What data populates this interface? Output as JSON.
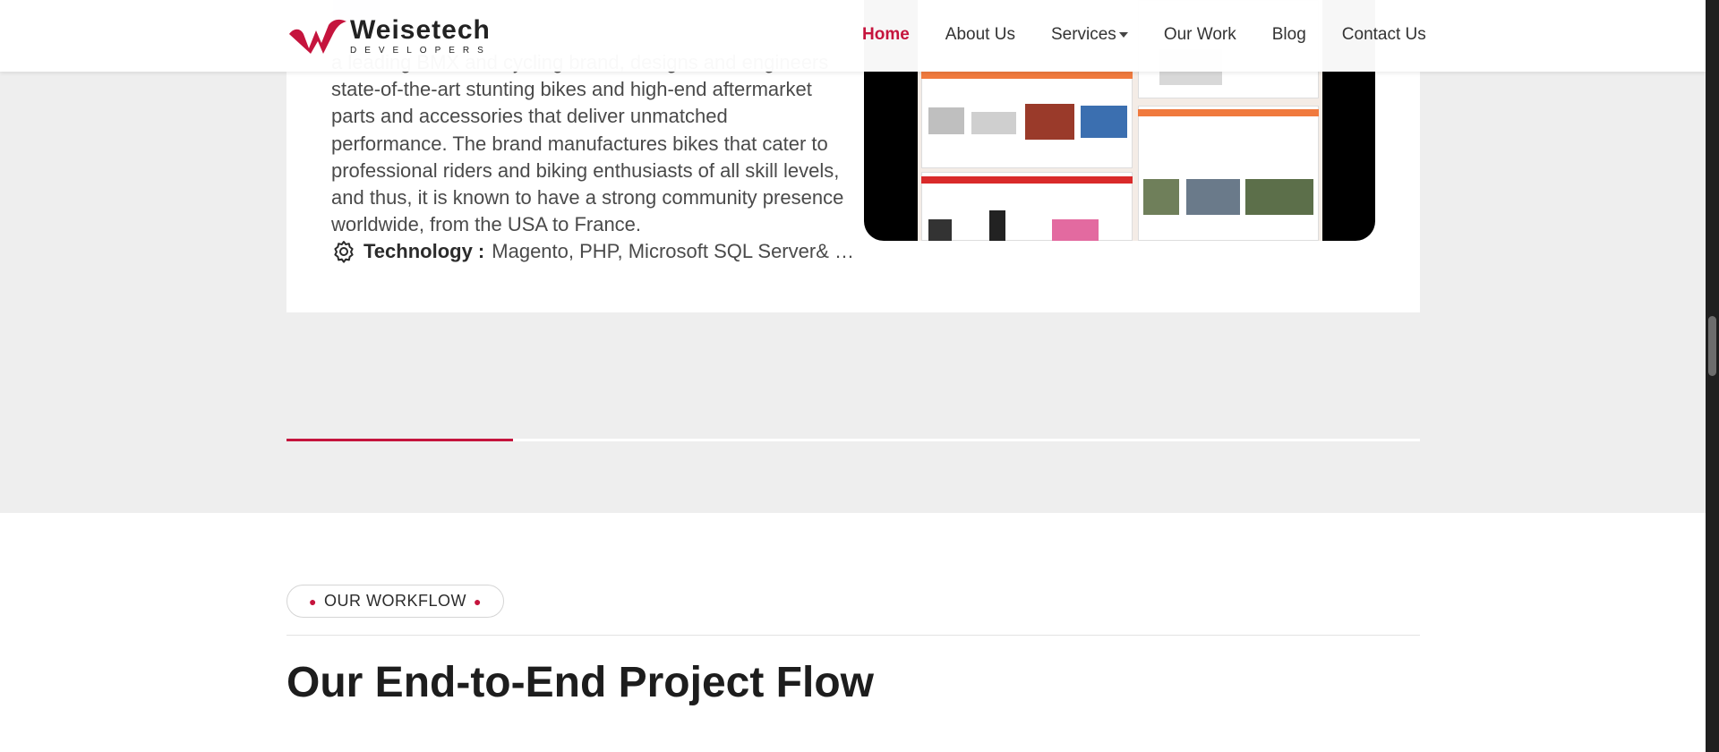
{
  "header": {
    "logo_name": "Weisetech",
    "logo_sub": "DEVELOPERS",
    "nav": [
      {
        "label": "Home",
        "active": true
      },
      {
        "label": "About Us"
      },
      {
        "label": "Services",
        "dropdown": true
      },
      {
        "label": "Our Work"
      },
      {
        "label": "Blog"
      },
      {
        "label": "Contact Us"
      }
    ]
  },
  "project": {
    "description": "a leading BMX and cycling brand, designs and engineers state-of-the-art stunting bikes and high-end aftermarket parts and accessories that deliver unmatched performance. The brand manufactures bikes that cater to professional riders and biking enthusiasts of all skill levels, and thus, it is known to have a strong community presence worldwide, from the USA to France.",
    "technology_label": "Technology :",
    "technology_value": "Magento, PHP, Microsoft SQL Server& SAGE ERP",
    "tech_icon": "gear-icon"
  },
  "slider": {
    "progress": 0.2
  },
  "workflow": {
    "tag": "OUR WORKFLOW",
    "title": "Our End-to-End Project Flow"
  },
  "colors": {
    "accent": "#c5143d",
    "section_bg": "#eeeeee"
  }
}
